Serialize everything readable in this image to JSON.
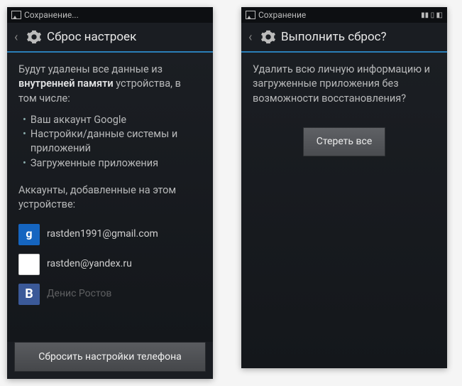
{
  "phone1": {
    "status_text": "Сохранение...",
    "title": "Сброс настроек",
    "intro_prefix": "Будут удалены все данные из ",
    "intro_bold": "внутренней памяти",
    "intro_suffix": " устройства, в том числе:",
    "bullets": [
      "Ваш аккаунт Google",
      "Настройки/данные системы и приложений",
      "Загруженные приложения"
    ],
    "accounts_heading": "Аккаунты, добавленные на этом устройстве:",
    "accounts": [
      {
        "icon": "g",
        "label": "rastden1991@gmail.com"
      },
      {
        "icon": "mail",
        "label": "rastden@yandex.ru"
      },
      {
        "icon": "vk",
        "label": "Денис Ростов"
      }
    ],
    "button": "Сбросить настройки телефона"
  },
  "phone2": {
    "status_text": "Сохранение",
    "title": "Выполнить сброс?",
    "body": "Удалить всю личную информацию и загруженные приложения без возможности восстановления?",
    "button": "Стереть все"
  },
  "colors": {
    "accent": "#2a7fb8"
  }
}
